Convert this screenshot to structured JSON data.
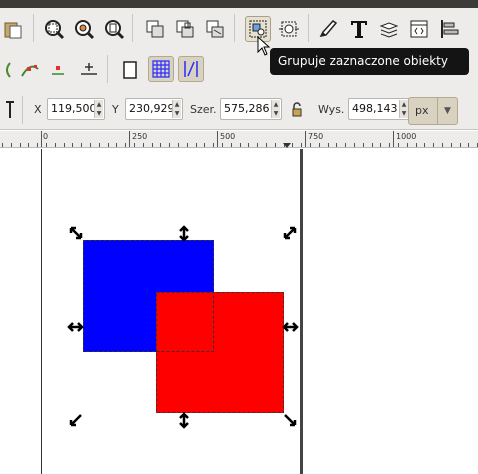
{
  "toolbar": {
    "tooltip": "Grupuje zaznaczone obiekty",
    "tools_row1": [
      "zoom-selection-icon",
      "zoom-drawing-icon",
      "zoom-page-icon",
      "duplicate-icon",
      "clone-icon",
      "unlink-clone-icon",
      "group-icon",
      "ungroup-icon",
      "xml-editor-icon",
      "text-tool-icon",
      "layers-icon",
      "document-properties-icon",
      "align-icon"
    ],
    "tools_row2": [
      "node-tool-icon",
      "bezier-tool-icon",
      "dot-icon",
      "snap-icon",
      "page-border-icon",
      "grid-icon",
      "guides-icon"
    ]
  },
  "coords": {
    "x_label": "X",
    "x_value": "119,500",
    "y_label": "Y",
    "y_value": "230,929",
    "w_label": "Szer.",
    "w_value": "575,286",
    "h_label": "Wys.",
    "h_value": "498,143",
    "unit": "px"
  },
  "ruler": {
    "labels": [
      "0",
      "250",
      "500",
      "750",
      "1000"
    ]
  },
  "colors": {
    "blue_rect": "#0000ff",
    "red_rect": "#ff0000",
    "toolbar_bg": "#edeceb",
    "pressed_bg": "#d9d2c1"
  }
}
